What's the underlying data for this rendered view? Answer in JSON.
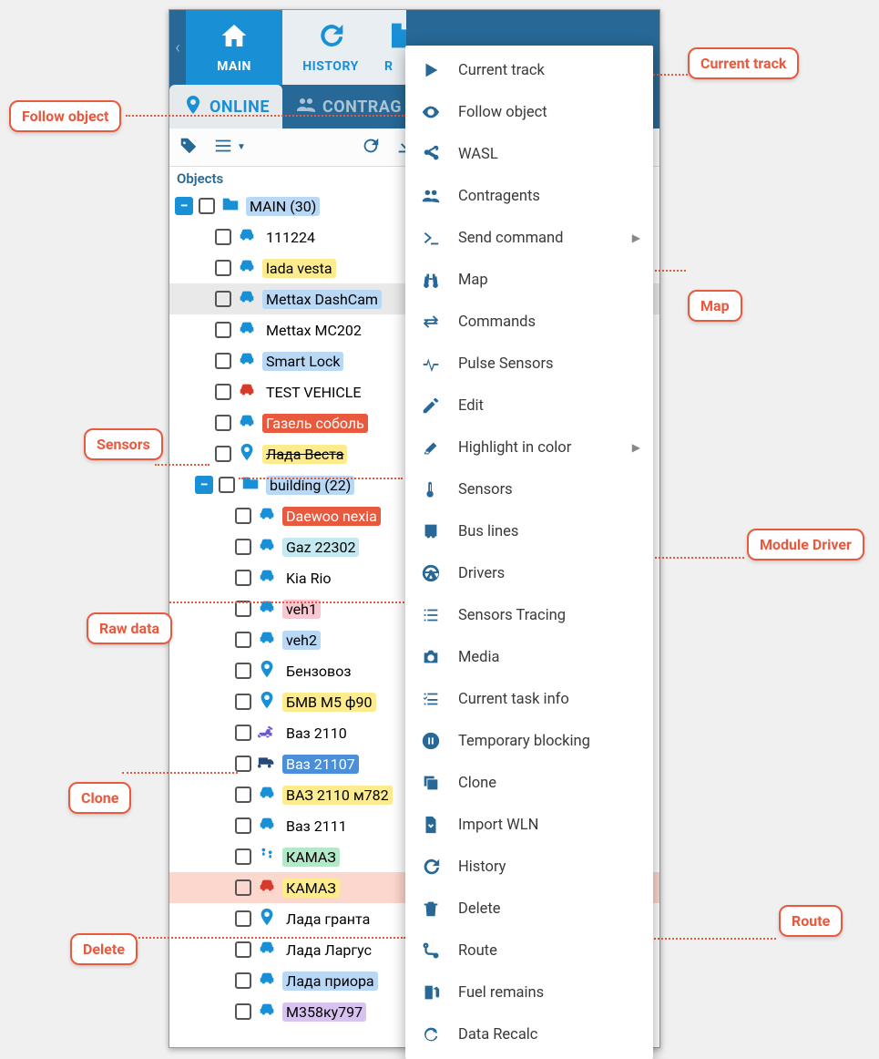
{
  "nav": {
    "main": "MAIN",
    "history": "HISTORY",
    "reports_partial": "R"
  },
  "subtabs": {
    "online": "ONLINE",
    "contragents_partial": "CONTRAG"
  },
  "objects_header": "Objects",
  "tree": {
    "root": {
      "label": "MAIN (30)"
    },
    "items1": [
      {
        "label": "111224",
        "hl": "",
        "icon": "car-blue"
      },
      {
        "label": "lada vesta",
        "hl": "hl-yellow",
        "icon": "car-blue"
      },
      {
        "label": "Mettax DashCam",
        "hl": "hl-blue",
        "icon": "car-blue",
        "sel": true
      },
      {
        "label": "Mettax MC202",
        "hl": "",
        "icon": "car-blue"
      },
      {
        "label": "Smart Lock",
        "hl": "hl-blue",
        "icon": "car-blue"
      },
      {
        "label": "TEST VEHICLE",
        "hl": "",
        "icon": "car-red"
      },
      {
        "label": "Газель соболь",
        "hl": "hl-red",
        "icon": "car-blue"
      },
      {
        "label": "Лада Веста",
        "hl": "hl-yellow",
        "icon": "pin",
        "strike": true
      }
    ],
    "sub": {
      "label": "building (22)"
    },
    "items2": [
      {
        "label": "Daewoo nexia",
        "hl": "hl-red",
        "icon": "car-blue"
      },
      {
        "label": "Gaz 22302",
        "hl": "hl-lightblue",
        "icon": "car-blue"
      },
      {
        "label": "Kia Rio",
        "hl": "",
        "icon": "car-blue"
      },
      {
        "label": "veh1",
        "hl": "hl-pink",
        "icon": "car-blue"
      },
      {
        "label": "veh2",
        "hl": "hl-blue",
        "icon": "car-blue"
      },
      {
        "label": "Бензовоз",
        "hl": "",
        "icon": "pin"
      },
      {
        "label": "БМВ М5 ф90",
        "hl": "hl-yellow",
        "icon": "pin"
      },
      {
        "label": "Ваз 2110",
        "hl": "",
        "icon": "excavator"
      },
      {
        "label": "Ваз 21107",
        "hl": "hl-bluefill",
        "icon": "truck"
      },
      {
        "label": "ВАЗ 2110 м782",
        "hl": "hl-yellow",
        "icon": "car-blue"
      },
      {
        "label": "Ваз 2111",
        "hl": "",
        "icon": "car-blue"
      },
      {
        "label": "КАМАЗ",
        "hl": "hl-green",
        "icon": "footprints"
      },
      {
        "label": "КАМАЗ",
        "hl": "hl-yellow",
        "icon": "car-red",
        "selred": true
      },
      {
        "label": "Лада гранта",
        "hl": "",
        "icon": "pin"
      },
      {
        "label": "Лада Ларгус",
        "hl": "",
        "icon": "car-blue"
      },
      {
        "label": "Лада приора",
        "hl": "hl-blue",
        "icon": "car-blue"
      },
      {
        "label": "М358ку797",
        "hl": "hl-purple",
        "icon": "car-blue"
      }
    ]
  },
  "context_menu": [
    {
      "label": "Current track",
      "icon": "play"
    },
    {
      "label": "Follow object",
      "icon": "eye"
    },
    {
      "label": "WASL",
      "icon": "share"
    },
    {
      "label": "Contragents",
      "icon": "users"
    },
    {
      "label": "Send command",
      "icon": "terminal",
      "sub": true
    },
    {
      "label": "Map",
      "icon": "binoculars"
    },
    {
      "label": "Commands",
      "icon": "exchange"
    },
    {
      "label": "Pulse Sensors",
      "icon": "pulse"
    },
    {
      "label": "Edit",
      "icon": "edit"
    },
    {
      "label": "Highlight in color",
      "icon": "highlighter",
      "sub": true
    },
    {
      "label": "Sensors",
      "icon": "thermometer"
    },
    {
      "label": "Bus lines",
      "icon": "bus"
    },
    {
      "label": "Drivers",
      "icon": "wheel"
    },
    {
      "label": "Sensors Tracing",
      "icon": "list"
    },
    {
      "label": "Media",
      "icon": "camera"
    },
    {
      "label": "Current task info",
      "icon": "tasks"
    },
    {
      "label": "Temporary blocking",
      "icon": "pause"
    },
    {
      "label": "Clone",
      "icon": "clone"
    },
    {
      "label": "Import WLN",
      "icon": "import"
    },
    {
      "label": "History",
      "icon": "history"
    },
    {
      "label": "Delete",
      "icon": "trash"
    },
    {
      "label": "Route",
      "icon": "route"
    },
    {
      "label": "Fuel remains",
      "icon": "fuel"
    },
    {
      "label": "Data Recalc",
      "icon": "recalc"
    }
  ],
  "callouts": {
    "current_track": "Current track",
    "follow_object": "Follow object",
    "map": "Map",
    "sensors": "Sensors",
    "module_driver": "Module Driver",
    "raw_data": "Raw data",
    "clone": "Clone",
    "route": "Route",
    "delete": "Delete"
  }
}
